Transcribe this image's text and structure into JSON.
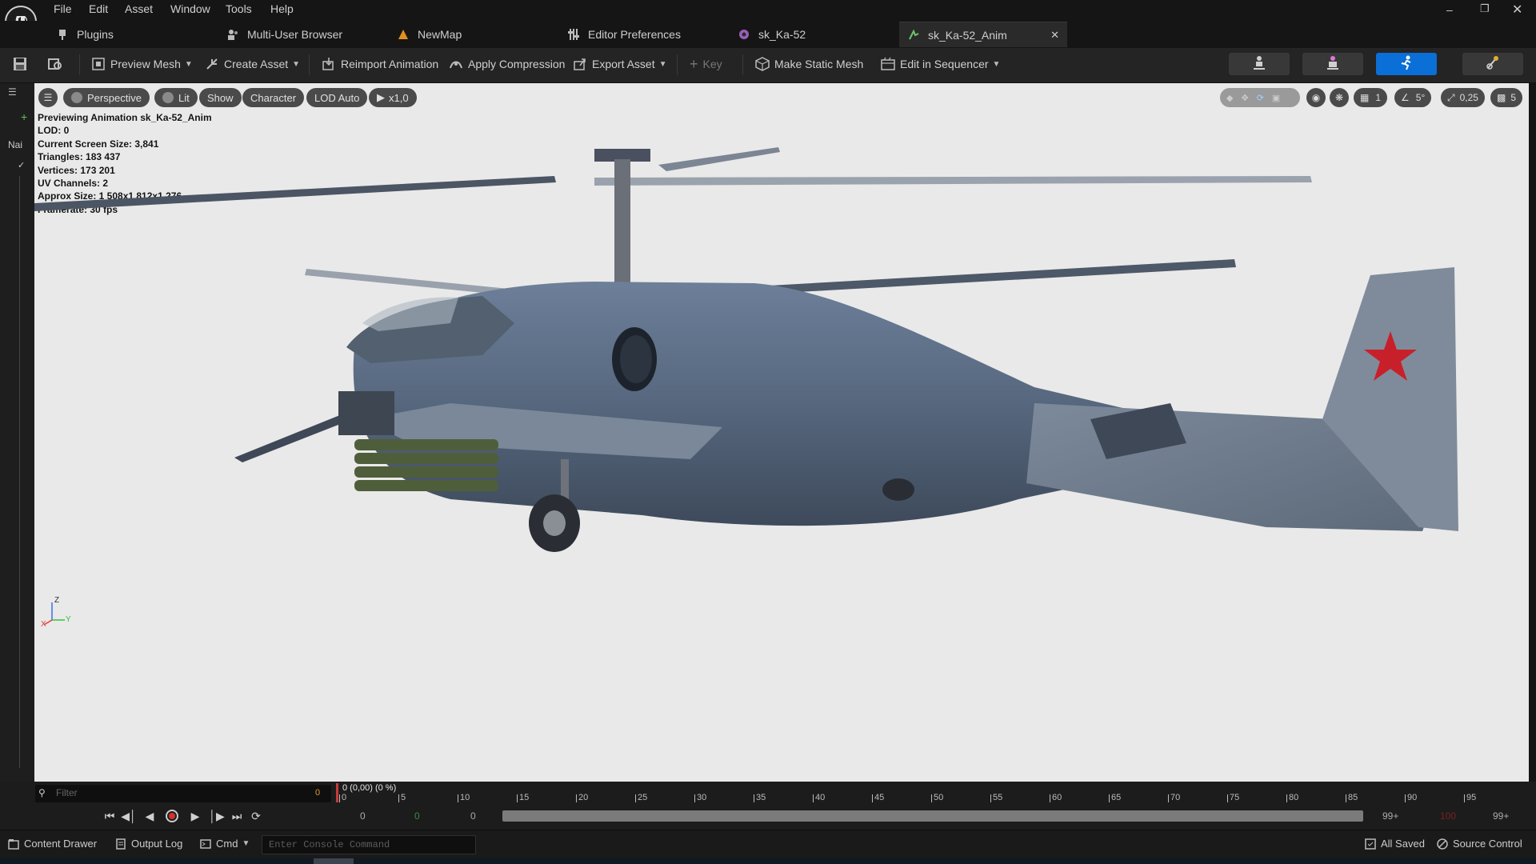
{
  "menu": [
    "File",
    "Edit",
    "Asset",
    "Window",
    "Tools",
    "Help"
  ],
  "tabs": [
    {
      "label": "Plugins"
    },
    {
      "label": "Multi-User Browser"
    },
    {
      "label": "NewMap"
    },
    {
      "label": "Editor Preferences"
    },
    {
      "label": "sk_Ka-52"
    },
    {
      "label": "sk_Ka-52_Anim"
    }
  ],
  "toolbar": {
    "preview_mesh": "Preview Mesh",
    "create_asset": "Create Asset",
    "reimport_animation": "Reimport Animation",
    "apply_compression": "Apply Compression",
    "export_asset": "Export Asset",
    "key": "Key",
    "make_static_mesh": "Make Static Mesh",
    "edit_in_sequencer": "Edit in Sequencer"
  },
  "left_strip": {
    "label": "Nai"
  },
  "viewport": {
    "buttons": {
      "perspective": "Perspective",
      "lit": "Lit",
      "show": "Show",
      "character": "Character",
      "lod": "LOD Auto",
      "speed": "x1,0"
    },
    "stats": [
      "Previewing Animation sk_Ka-52_Anim",
      "LOD: 0",
      "Current Screen Size: 3,841",
      "Triangles: 183 437",
      "Vertices: 173 201",
      "UV Channels: 2",
      "Approx Size: 1 508x1 812x1 276",
      "Framerate: 30 fps"
    ],
    "right_controls": {
      "grid": "1",
      "angle": "5°",
      "scale": "0,25",
      "camera": "5"
    },
    "axes": {
      "z": "Z",
      "x": "X",
      "y": "Y"
    }
  },
  "timeline": {
    "filter_placeholder": "Filter",
    "filter_count": "0",
    "current": "0 (0,00) (0 %)",
    "ticks": [
      "0",
      "5",
      "10",
      "15",
      "20",
      "25",
      "30",
      "35",
      "40",
      "45",
      "50",
      "55",
      "60",
      "65",
      "70",
      "75",
      "80",
      "85",
      "90",
      "95"
    ],
    "start_a": "0",
    "start_b": "0",
    "start_c": "0",
    "end_a": "99+",
    "end_b": "100",
    "end_c": "99+"
  },
  "statusbar": {
    "content_drawer": "Content Drawer",
    "output_log": "Output Log",
    "cmd": "Cmd",
    "console_placeholder": "Enter Console Command",
    "all_saved": "All Saved",
    "source_control": "Source Control"
  },
  "colors": {
    "accent": "#0a6fd6",
    "viewport_bg": "#e9e9e9"
  }
}
